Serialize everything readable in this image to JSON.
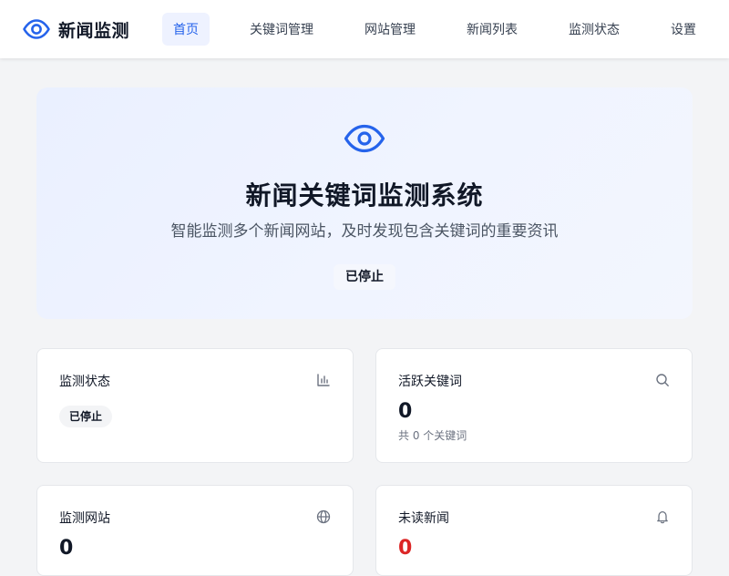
{
  "app": {
    "name": "新闻监测",
    "accent_color": "#2563eb",
    "alert_color": "#dc2626"
  },
  "nav": {
    "items": [
      {
        "label": "首页",
        "active": true
      },
      {
        "label": "关键词管理",
        "active": false
      },
      {
        "label": "网站管理",
        "active": false
      },
      {
        "label": "新闻列表",
        "active": false
      },
      {
        "label": "监测状态",
        "active": false
      },
      {
        "label": "设置",
        "active": false
      }
    ]
  },
  "hero": {
    "icon": "eye-icon",
    "title": "新闻关键词监测系统",
    "subtitle": "智能监测多个新闻网站，及时发现包含关键词的重要资讯",
    "status": "已停止"
  },
  "cards": {
    "monitor_status": {
      "title": "监测状态",
      "icon": "bar-chart-icon",
      "badge": "已停止"
    },
    "active_keywords": {
      "title": "活跃关键词",
      "icon": "search-icon",
      "value": "0",
      "sub": "共 0 个关键词"
    },
    "monitored_sites": {
      "title": "监测网站",
      "icon": "globe-icon",
      "value": "0"
    },
    "unread_news": {
      "title": "未读新闻",
      "icon": "bell-icon",
      "value": "0"
    }
  }
}
